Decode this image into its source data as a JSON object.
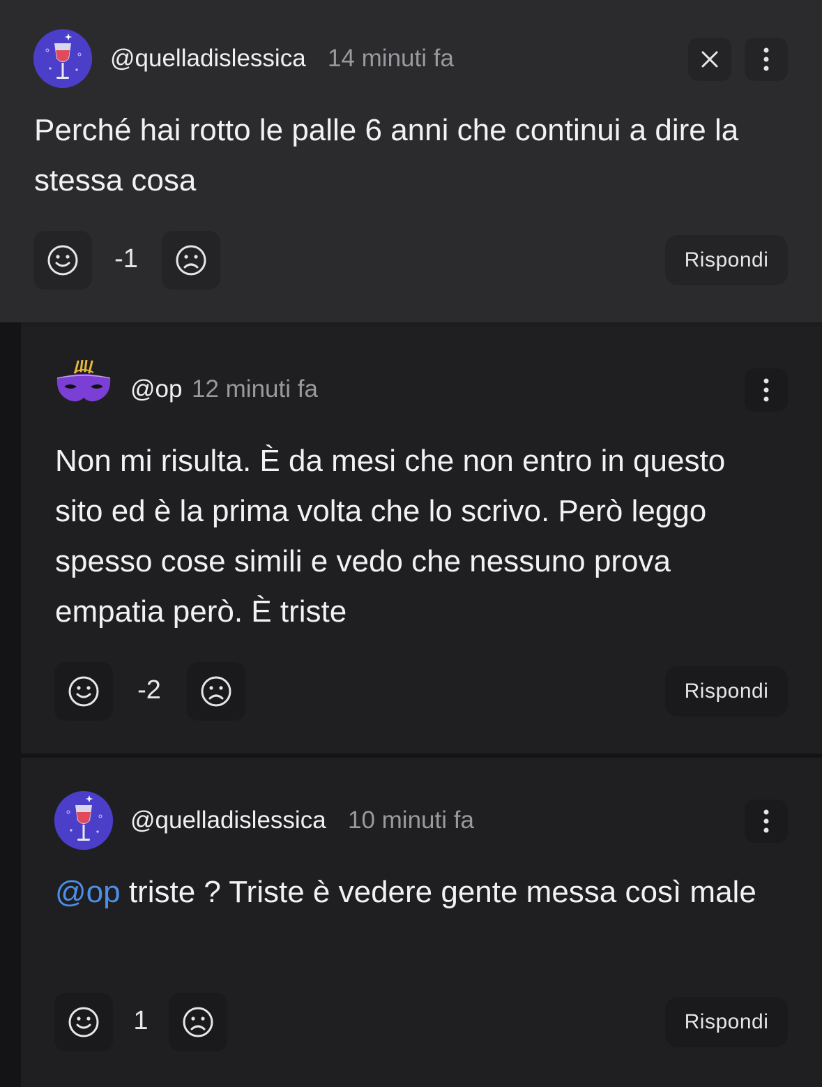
{
  "comments": [
    {
      "username": "@quelladislessica",
      "time": "14 minuti fa",
      "text": "Perché hai rotto le palle 6 anni che continui a dire la stessa cosa",
      "score": "-1",
      "reply_label": "Rispondi",
      "avatar_icon": "wine-glass-icon"
    },
    {
      "username": "@op",
      "time": "12 minuti fa",
      "text": "Non mi risulta. È da mesi che non entro in questo sito ed è la prima volta che lo scrivo. Però leggo spesso cose simili e vedo che nessuno prova empatia però. È triste",
      "score": "-2",
      "reply_label": "Rispondi",
      "avatar_icon": "carnival-mask-icon"
    },
    {
      "username": "@quelladislessica",
      "time": "10 minuti fa",
      "mention": "@op",
      "text": " triste ? Triste è vedere gente messa così male",
      "score": "1",
      "reply_label": "Rispondi",
      "avatar_icon": "wine-glass-icon"
    }
  ],
  "colors": {
    "background": "#1c1c1e",
    "mention": "#4c8fe8",
    "avatar_purple": "#4b3fc9"
  }
}
